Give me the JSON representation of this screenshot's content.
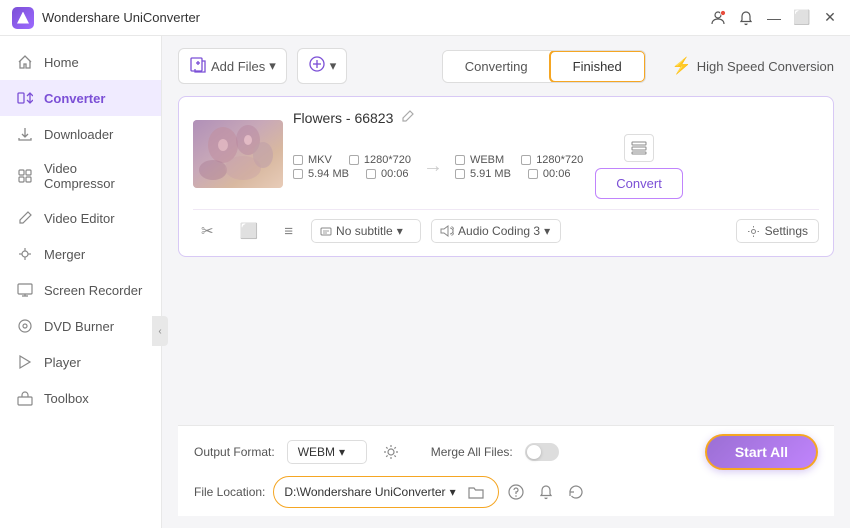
{
  "titleBar": {
    "appName": "Wondershare UniConverter",
    "controls": [
      "user-icon",
      "bell-icon",
      "minimize",
      "maximize",
      "close"
    ]
  },
  "sidebar": {
    "items": [
      {
        "id": "home",
        "label": "Home",
        "icon": "🏠",
        "active": false
      },
      {
        "id": "converter",
        "label": "Converter",
        "icon": "🔄",
        "active": true
      },
      {
        "id": "downloader",
        "label": "Downloader",
        "icon": "⬇️",
        "active": false
      },
      {
        "id": "video-compressor",
        "label": "Video Compressor",
        "icon": "🗜️",
        "active": false
      },
      {
        "id": "video-editor",
        "label": "Video Editor",
        "icon": "✂️",
        "active": false
      },
      {
        "id": "merger",
        "label": "Merger",
        "icon": "⊕",
        "active": false
      },
      {
        "id": "screen-recorder",
        "label": "Screen Recorder",
        "icon": "🖥️",
        "active": false
      },
      {
        "id": "dvd-burner",
        "label": "DVD Burner",
        "icon": "💿",
        "active": false
      },
      {
        "id": "player",
        "label": "Player",
        "icon": "▶️",
        "active": false
      },
      {
        "id": "toolbox",
        "label": "Toolbox",
        "icon": "🧰",
        "active": false
      }
    ],
    "collapseIcon": "‹"
  },
  "toolbar": {
    "addFileLabel": "Add Files",
    "addDropLabel": "Add",
    "convertingTab": "Converting",
    "finishedTab": "Finished",
    "activeTab": "Finished",
    "speedLabel": "High Speed Conversion"
  },
  "fileCard": {
    "fileName": "Flowers - 66823",
    "editIcon": "✏️",
    "source": {
      "format": "MKV",
      "resolution": "1280*720",
      "size": "5.94 MB",
      "duration": "00:06"
    },
    "output": {
      "format": "WEBM",
      "resolution": "1280*720",
      "size": "5.91 MB",
      "duration": "00:06"
    },
    "convertBtn": "Convert",
    "subtitleLabel": "No subtitle",
    "audioLabel": "Audio Coding 3",
    "settingsLabel": "Settings"
  },
  "bottomBar": {
    "outputFormatLabel": "Output Format:",
    "outputFormat": "WEBM",
    "mergeLabel": "Merge All Files:",
    "fileLocationLabel": "File Location:",
    "fileLocation": "D:\\Wondershare UniConverter",
    "startAllLabel": "Start All"
  },
  "footerIcons": [
    "help-icon",
    "notification-icon",
    "refresh-icon"
  ]
}
